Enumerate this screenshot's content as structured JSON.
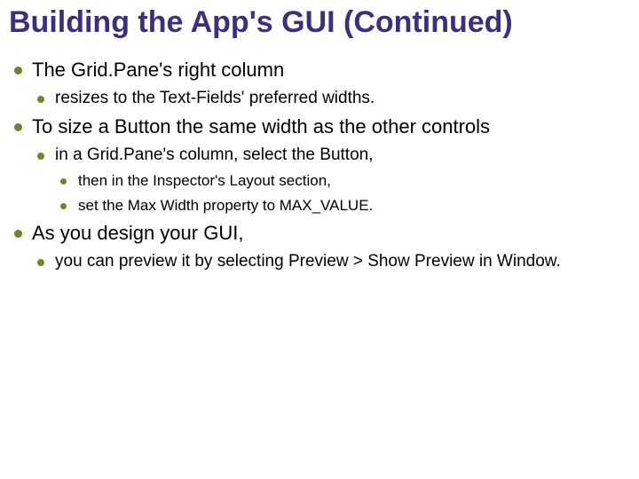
{
  "title": "Building the App's GUI (Continued)",
  "bullets": {
    "b0": {
      "text": "The Grid.Pane's right column",
      "sub": {
        "s0": {
          "text": "resizes to the Text-Fields' preferred widths."
        }
      }
    },
    "b1": {
      "text": "To size a Button the same width as the other controls",
      "sub": {
        "s0": {
          "text": "in a Grid.Pane's column, select the Button,",
          "sub": {
            "t0": {
              "text": "then in the Inspector's Layout section,"
            },
            "t1": {
              "text": "set the Max Width property to MAX_VALUE."
            }
          }
        }
      }
    },
    "b2": {
      "text": "As you design your GUI,",
      "sub": {
        "s0": {
          "text": "you can preview it by selecting Preview > Show Preview in Window."
        }
      }
    }
  }
}
